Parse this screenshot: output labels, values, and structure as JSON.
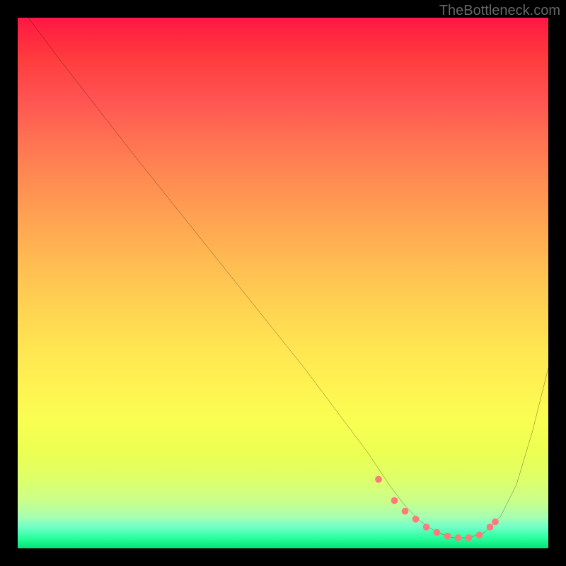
{
  "watermark": "TheBottleneck.com",
  "chart_data": {
    "type": "line",
    "title": "",
    "xlabel": "",
    "ylabel": "",
    "xlim": [
      0,
      100
    ],
    "ylim": [
      0,
      100
    ],
    "comment": "Bottleneck-style curve with heat gradient background (red=high bottleneck, green=low). The black curve shows a V-shape with minimum around x≈75-85. Salmon dots mark the near-optimal flat region.",
    "series": [
      {
        "name": "bottleneck-curve",
        "color": "#000",
        "x": [
          2,
          8,
          15,
          22,
          30,
          38,
          46,
          54,
          60,
          66,
          70,
          73,
          76,
          79,
          82,
          85,
          88,
          91,
          94,
          97,
          100
        ],
        "values": [
          100,
          92,
          83,
          74,
          64,
          54,
          44,
          34,
          26,
          18,
          12,
          8,
          5,
          3,
          2,
          2,
          3,
          6,
          12,
          22,
          34
        ]
      }
    ],
    "markers": {
      "name": "optimal-region-dots",
      "color": "#ff7b7b",
      "x": [
        68,
        71,
        73,
        75,
        77,
        79,
        81,
        83,
        85,
        87,
        89,
        90
      ],
      "values": [
        13,
        9,
        7,
        5.5,
        4,
        3,
        2.3,
        2,
        2,
        2.5,
        4,
        5
      ]
    }
  }
}
